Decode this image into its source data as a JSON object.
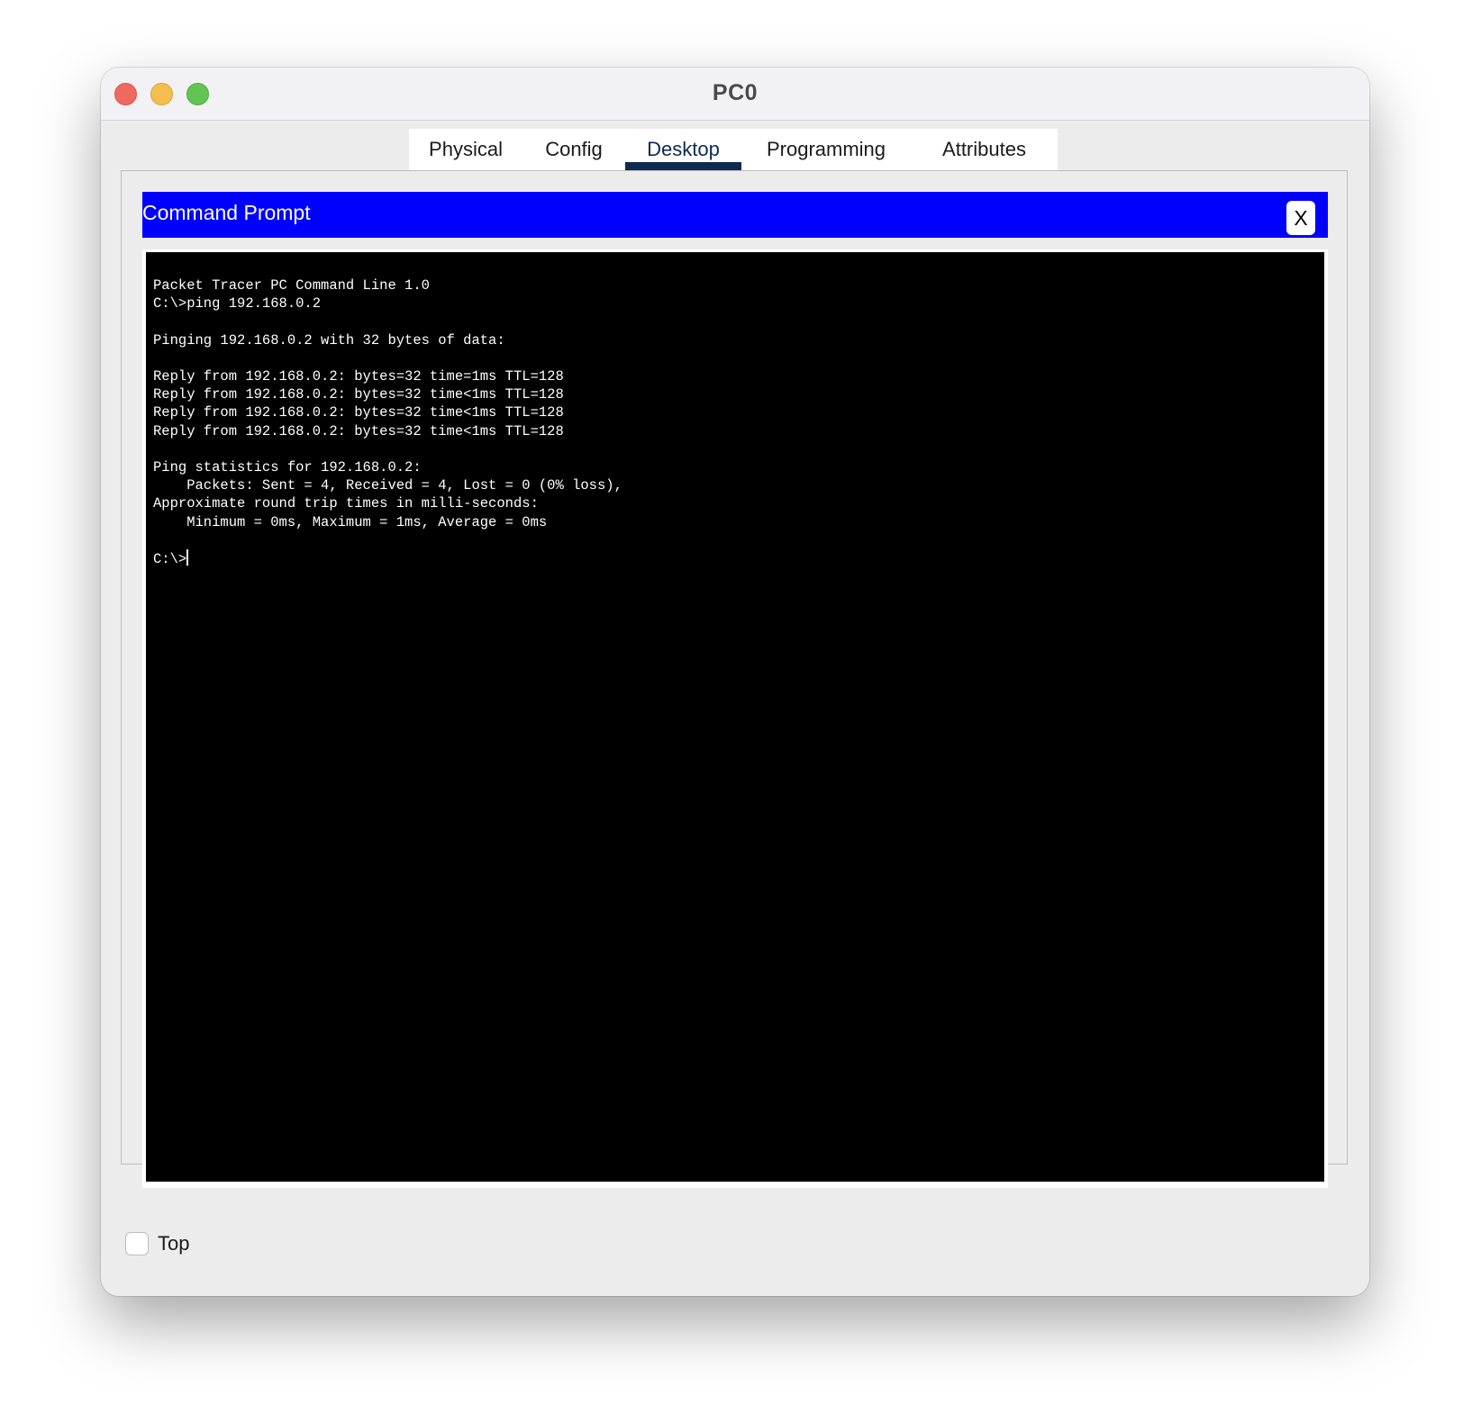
{
  "window": {
    "title": "PC0"
  },
  "tabs": [
    {
      "label": "Physical",
      "active": false
    },
    {
      "label": "Config",
      "active": false
    },
    {
      "label": "Desktop",
      "active": true
    },
    {
      "label": "Programming",
      "active": false
    },
    {
      "label": "Attributes",
      "active": false
    }
  ],
  "command_prompt": {
    "title": "Command Prompt",
    "close_label": "X",
    "header_color": "#0000ff",
    "output": "Packet Tracer PC Command Line 1.0\nC:\\>ping 192.168.0.2\n\nPinging 192.168.0.2 with 32 bytes of data:\n\nReply from 192.168.0.2: bytes=32 time=1ms TTL=128\nReply from 192.168.0.2: bytes=32 time<1ms TTL=128\nReply from 192.168.0.2: bytes=32 time<1ms TTL=128\nReply from 192.168.0.2: bytes=32 time<1ms TTL=128\n\nPing statistics for 192.168.0.2:\n    Packets: Sent = 4, Received = 4, Lost = 0 (0% loss),\nApproximate round trip times in milli-seconds:\n    Minimum = 0ms, Maximum = 1ms, Average = 0ms\n\n",
    "prompt": "C:\\>"
  },
  "footer": {
    "top_checkbox_label": "Top",
    "top_checked": false
  }
}
